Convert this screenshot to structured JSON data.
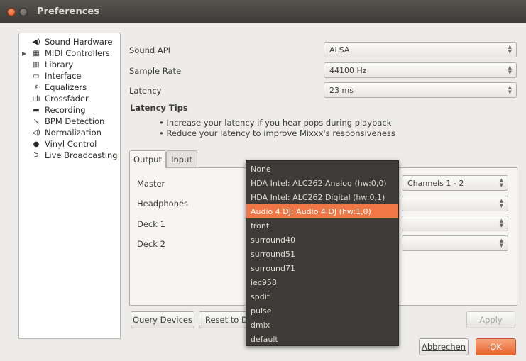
{
  "window": {
    "title": "Preferences"
  },
  "sidebar": {
    "items": [
      {
        "label": "Sound Hardware",
        "icon": "speaker-icon",
        "glyph": "◀)"
      },
      {
        "label": "MIDI Controllers",
        "icon": "midi-icon",
        "glyph": "▦"
      },
      {
        "label": "Library",
        "icon": "library-icon",
        "glyph": "▥"
      },
      {
        "label": "Interface",
        "icon": "monitor-icon",
        "glyph": "▭"
      },
      {
        "label": "Equalizers",
        "icon": "equalizer-icon",
        "glyph": "♯"
      },
      {
        "label": "Crossfader",
        "icon": "crossfader-icon",
        "glyph": "ıllı"
      },
      {
        "label": "Recording",
        "icon": "recording-icon",
        "glyph": "▬"
      },
      {
        "label": "BPM Detection",
        "icon": "bpm-icon",
        "glyph": "↘"
      },
      {
        "label": "Normalization",
        "icon": "normalization-icon",
        "glyph": "◁)"
      },
      {
        "label": "Vinyl Control",
        "icon": "vinyl-icon",
        "glyph": "●"
      },
      {
        "label": "Live Broadcasting",
        "icon": "broadcast-icon",
        "glyph": "⚞"
      }
    ]
  },
  "settings": {
    "sound_api": {
      "label": "Sound API",
      "value": "ALSA"
    },
    "sample_rate": {
      "label": "Sample Rate",
      "value": "44100 Hz"
    },
    "latency": {
      "label": "Latency",
      "value": "23 ms"
    }
  },
  "tips": {
    "title": "Latency Tips",
    "items": [
      "• Increase your latency if you hear pops during playback",
      "• Reduce your latency to improve Mixxx's responsiveness"
    ]
  },
  "tabs": [
    {
      "label": "Output"
    },
    {
      "label": "Input"
    }
  ],
  "output": {
    "rows": [
      {
        "label": "Master",
        "channels": "Channels 1 - 2"
      },
      {
        "label": "Headphones",
        "channels": ""
      },
      {
        "label": "Deck 1",
        "channels": ""
      },
      {
        "label": "Deck 2",
        "channels": ""
      }
    ]
  },
  "buttons": {
    "query": "Query Devices",
    "reset": "Reset to D",
    "apply": "Apply",
    "cancel": "Abbrechen",
    "ok": "OK"
  },
  "popup": {
    "highlighted_index": 3,
    "items": [
      "None",
      "HDA Intel: ALC262 Analog (hw:0,0)",
      "HDA Intel: ALC262 Digital (hw:0,1)",
      "Audio 4 DJ: Audio 4 DJ (hw:1,0)",
      "front",
      "surround40",
      "surround51",
      "surround71",
      "iec958",
      "spdif",
      "pulse",
      "dmix",
      "default"
    ]
  },
  "colors": {
    "accent": "#f07746",
    "titlebar": "#3c3b37",
    "close": "#df4b16"
  }
}
